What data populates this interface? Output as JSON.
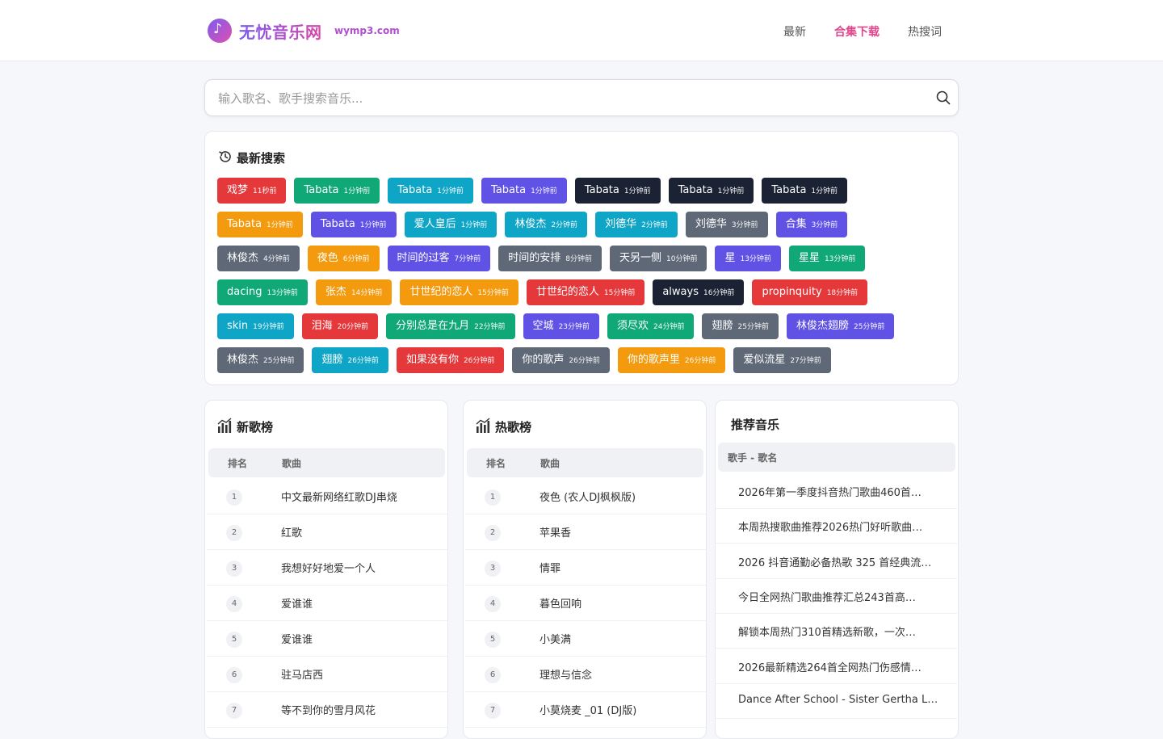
{
  "header": {
    "logo_glyph": "♪",
    "site_name": "无忧音乐网",
    "site_domain": "wymp3.com",
    "nav": [
      {
        "label": "最新",
        "active": false
      },
      {
        "label": "合集下载",
        "active": true
      },
      {
        "label": "热搜词",
        "active": false
      }
    ]
  },
  "search": {
    "placeholder": "输入歌名、歌手搜索音乐...",
    "value": ""
  },
  "recent": {
    "title": "最新搜索",
    "rows": [
      [
        {
          "text": "戏梦",
          "ago": "11秒前",
          "color": "#e5383b"
        },
        {
          "text": "Tabata",
          "ago": "1分钟前",
          "color": "#10a876"
        },
        {
          "text": "Tabata",
          "ago": "1分钟前",
          "color": "#0ea5c6"
        },
        {
          "text": "Tabata",
          "ago": "1分钟前",
          "color": "#6152e6"
        },
        {
          "text": "Tabata",
          "ago": "1分钟前",
          "color": "#1a2233"
        },
        {
          "text": "Tabata",
          "ago": "1分钟前",
          "color": "#1a2233"
        },
        {
          "text": "Tabata",
          "ago": "1分钟前",
          "color": "#1a2233"
        }
      ],
      [
        {
          "text": "Tabata",
          "ago": "1分钟前",
          "color": "#f39a0f"
        },
        {
          "text": "Tabata",
          "ago": "1分钟前",
          "color": "#6152e6"
        },
        {
          "text": "爱人皇后",
          "ago": "1分钟前",
          "color": "#0ea5c6"
        },
        {
          "text": "林俊杰",
          "ago": "2分钟前",
          "color": "#0ea5c6"
        },
        {
          "text": "刘德华",
          "ago": "2分钟前",
          "color": "#0ea5c6"
        },
        {
          "text": "刘德华",
          "ago": "3分钟前",
          "color": "#5f6877"
        },
        {
          "text": "合集",
          "ago": "3分钟前",
          "color": "#6152e6"
        }
      ],
      [
        {
          "text": "林俊杰",
          "ago": "4分钟前",
          "color": "#5f6877"
        },
        {
          "text": "夜色",
          "ago": "6分钟前",
          "color": "#f39a0f"
        },
        {
          "text": "时间的过客",
          "ago": "7分钟前",
          "color": "#6152e6"
        },
        {
          "text": "时间的安排",
          "ago": "8分钟前",
          "color": "#5f6877"
        },
        {
          "text": "天另一侧",
          "ago": "10分钟前",
          "color": "#5f6877"
        },
        {
          "text": "星",
          "ago": "13分钟前",
          "color": "#6152e6"
        },
        {
          "text": "星星",
          "ago": "13分钟前",
          "color": "#10a876"
        }
      ],
      [
        {
          "text": "dacing",
          "ago": "13分钟前",
          "color": "#10a876"
        },
        {
          "text": "张杰",
          "ago": "14分钟前",
          "color": "#f39a0f"
        },
        {
          "text": "廿世纪的恋人",
          "ago": "15分钟前",
          "color": "#f39a0f"
        },
        {
          "text": "廿世纪的恋人",
          "ago": "15分钟前",
          "color": "#e5383b"
        },
        {
          "text": "always",
          "ago": "16分钟前",
          "color": "#1a2233"
        },
        {
          "text": "propinquity",
          "ago": "18分钟前",
          "color": "#e5383b"
        }
      ],
      [
        {
          "text": "skin",
          "ago": "19分钟前",
          "color": "#0ea5c6"
        },
        {
          "text": "泪海",
          "ago": "20分钟前",
          "color": "#e5383b"
        },
        {
          "text": "分别总是在九月",
          "ago": "22分钟前",
          "color": "#10a876"
        },
        {
          "text": "空城",
          "ago": "23分钟前",
          "color": "#6152e6"
        },
        {
          "text": "须尽欢",
          "ago": "24分钟前",
          "color": "#10a876"
        },
        {
          "text": "翅膀",
          "ago": "25分钟前",
          "color": "#5f6877"
        },
        {
          "text": "林俊杰翅膀",
          "ago": "25分钟前",
          "color": "#6152e6"
        }
      ],
      [
        {
          "text": "林俊杰",
          "ago": "25分钟前",
          "color": "#5f6877"
        },
        {
          "text": "翅膀",
          "ago": "26分钟前",
          "color": "#0ea5c6"
        },
        {
          "text": "如果没有你",
          "ago": "26分钟前",
          "color": "#e5383b"
        },
        {
          "text": "你的歌声",
          "ago": "26分钟前",
          "color": "#5f6877"
        },
        {
          "text": "你的歌声里",
          "ago": "26分钟前",
          "color": "#f39a0f"
        },
        {
          "text": "爱似流星",
          "ago": "27分钟前",
          "color": "#5f6877"
        }
      ]
    ]
  },
  "new_chart": {
    "title": "新歌榜",
    "col_rank": "排名",
    "col_song": "歌曲",
    "items": [
      {
        "rank": "1",
        "song": "中文最新网络红歌DJ串烧"
      },
      {
        "rank": "2",
        "song": "红歌"
      },
      {
        "rank": "3",
        "song": "我想好好地爱一个人"
      },
      {
        "rank": "4",
        "song": "爱谁谁"
      },
      {
        "rank": "5",
        "song": "爱谁谁"
      },
      {
        "rank": "6",
        "song": "驻马店西"
      },
      {
        "rank": "7",
        "song": "等不到你的雪月风花"
      }
    ]
  },
  "hot_chart": {
    "title": "热歌榜",
    "col_rank": "排名",
    "col_song": "歌曲",
    "items": [
      {
        "rank": "1",
        "song": "夜色 (农人DJ枫枫版)"
      },
      {
        "rank": "2",
        "song": "苹果香"
      },
      {
        "rank": "3",
        "song": "情罪"
      },
      {
        "rank": "4",
        "song": "暮色回响"
      },
      {
        "rank": "5",
        "song": "小美满"
      },
      {
        "rank": "6",
        "song": "理想与信念"
      },
      {
        "rank": "7",
        "song": "小莫烧麦 _01 (DJ版)"
      }
    ]
  },
  "recommend": {
    "title": "推荐音乐",
    "header": "歌手 - 歌名",
    "items": [
      "2026年第一季度抖音热门歌曲460首…",
      "本周热搜歌曲推荐2026热门好听歌曲…",
      "2026 抖音通勤必备热歌 325 首经典流…",
      "今日全网热门歌曲推荐汇总243首高…",
      "解锁本周热门310首精选新歌，一次…",
      "2026最新精选264首全网热门伤感情…",
      "Dance After School - Sister Gertha L…"
    ]
  },
  "colors": {
    "accent": "#e0468c",
    "brand_start": "#7b5cf0",
    "brand_end": "#d946a8"
  }
}
